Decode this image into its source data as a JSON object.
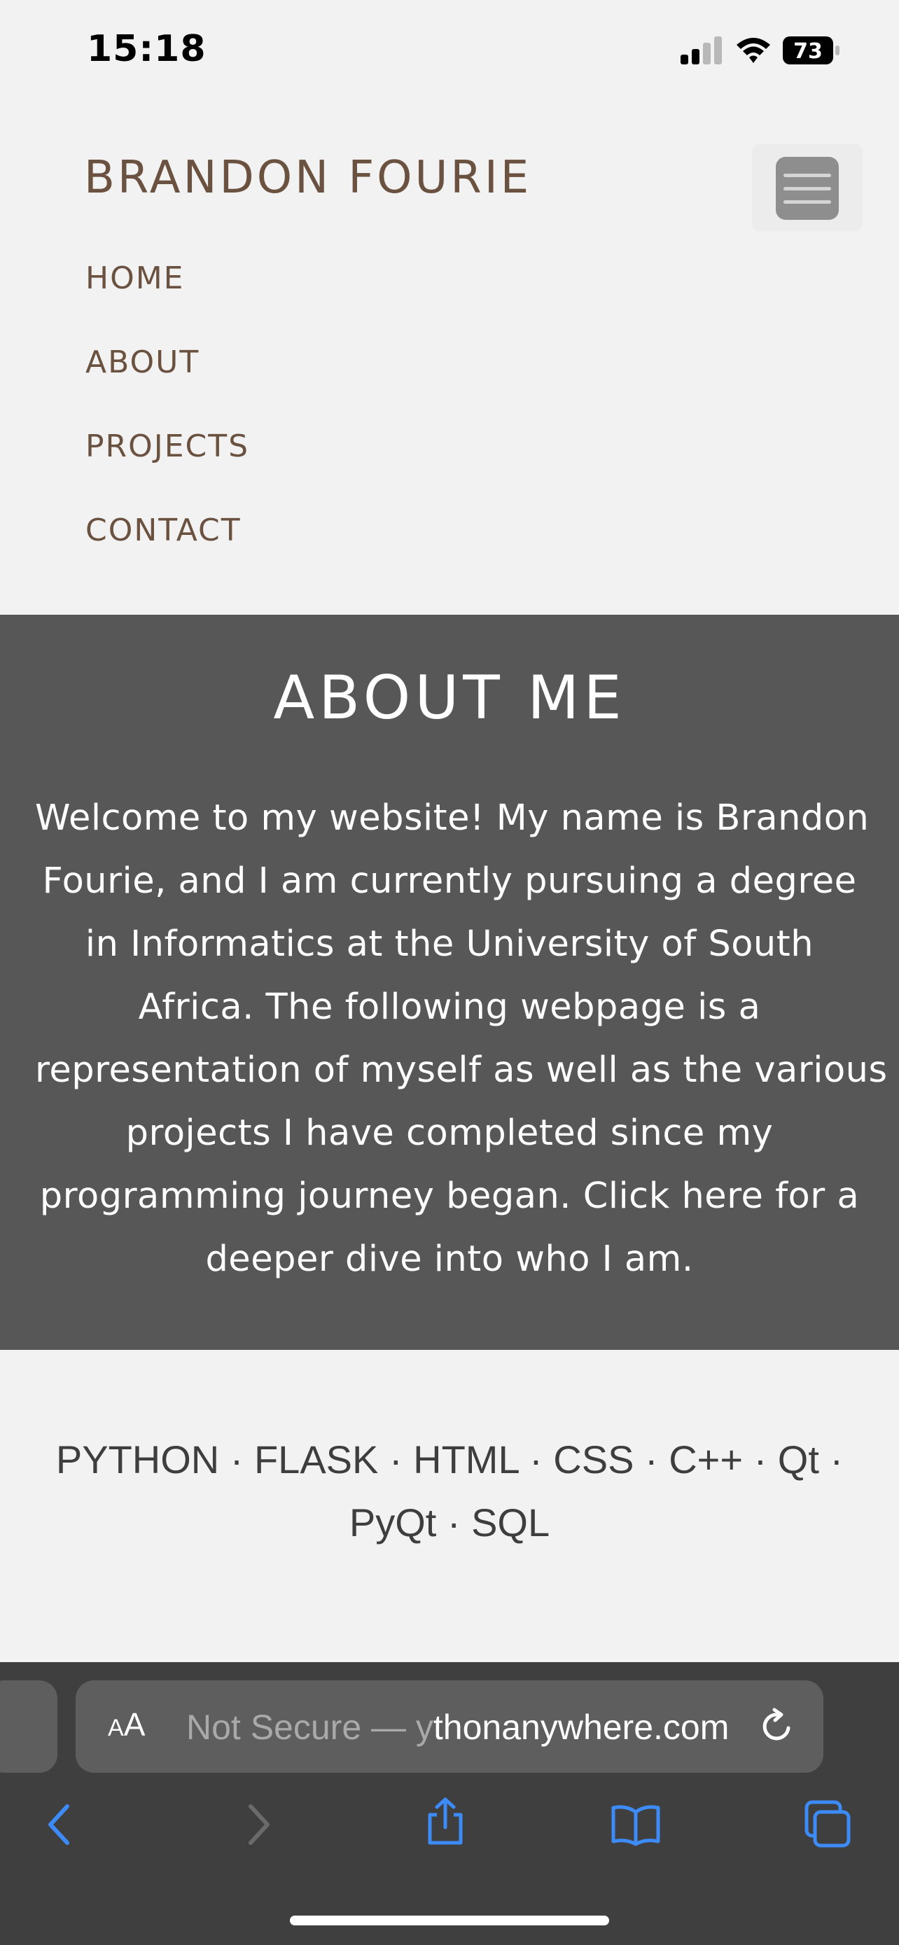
{
  "status_bar": {
    "time": "15:18",
    "battery_level": "73",
    "signal_bars_filled": 2,
    "signal_bars_total": 4
  },
  "header": {
    "site_title": "BRANDON FOURIE",
    "menu_icon": "hamburger-icon"
  },
  "nav": {
    "items": [
      {
        "label": "HOME"
      },
      {
        "label": "ABOUT"
      },
      {
        "label": "PROJECTS"
      },
      {
        "label": "CONTACT"
      }
    ]
  },
  "about": {
    "heading": "ABOUT ME",
    "lines": [
      "Welcome to my website! My name is Brandon",
      "Fourie, and I am currently pursuing a degree",
      "in Informatics at the University of South",
      "Africa. The following webpage is a",
      "representation of myself as well as the various",
      "projects I have completed since my",
      "programming journey began. Click here for a",
      "deeper dive into who I am."
    ]
  },
  "skills": {
    "lines": [
      "PYTHON · FLASK · HTML · CSS · C++ · Qt ·",
      "PyQt · SQL"
    ]
  },
  "browser": {
    "aa_small": "A",
    "aa_big": "A",
    "security_text": "Not Secure — y",
    "domain_text": "thonanywhere.com",
    "icons": [
      "back-icon",
      "forward-icon",
      "share-icon",
      "bookmarks-icon",
      "tabs-icon",
      "reload-icon"
    ]
  },
  "colors": {
    "page_background": "#f2f2f2",
    "brand_brown": "#6b5240",
    "about_background": "#575757",
    "chrome_background": "#3f3f3f",
    "ios_blue": "#3d8bf7"
  }
}
